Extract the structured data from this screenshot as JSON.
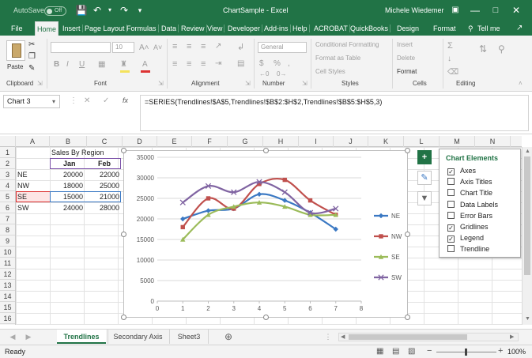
{
  "titlebar": {
    "autosave": "AutoSave",
    "autosave_state": "Off",
    "title": "ChartSample  -  Excel",
    "user": "Michele Wiedemer"
  },
  "ribbon_tabs": [
    "File",
    "Home",
    "Insert",
    "Page Layout",
    "Formulas",
    "Data",
    "Review",
    "View",
    "Developer",
    "Add-ins",
    "Help",
    "ACROBAT",
    "QuickBooks",
    "Design",
    "Format"
  ],
  "tell_me": "Tell me",
  "ribbon": {
    "clipboard": {
      "paste": "Paste",
      "label": "Clipboard"
    },
    "font": {
      "label": "Font",
      "size": "10",
      "bold": "B",
      "italic": "I",
      "underline": "U"
    },
    "alignment": {
      "label": "Alignment"
    },
    "number": {
      "label": "Number",
      "format": "General"
    },
    "styles": {
      "label": "Styles",
      "conditional": "Conditional Formatting",
      "table": "Format as Table",
      "cell": "Cell Styles"
    },
    "cells": {
      "label": "Cells",
      "insert": "Insert",
      "delete": "Delete",
      "format": "Format"
    },
    "editing": {
      "label": "Editing"
    }
  },
  "namebox": "Chart 3",
  "formula": "=SERIES(Trendlines!$A$5,Trendlines!$B$2:$H$2,Trendlines!$B$5:$H$5,3)",
  "columns": [
    "A",
    "B",
    "C",
    "D",
    "E",
    "F",
    "G",
    "H",
    "I",
    "J",
    "K",
    "L",
    "M",
    "N"
  ],
  "rows": [
    "1",
    "2",
    "3",
    "4",
    "5",
    "6",
    "7",
    "8",
    "9",
    "10",
    "11",
    "12",
    "13",
    "14",
    "15",
    "16"
  ],
  "sheet": {
    "title": "Sales By Region",
    "hdr_jan": "Jan",
    "hdr_feb": "Feb",
    "rows": [
      {
        "region": "NE",
        "jan": "20000",
        "feb": "22000"
      },
      {
        "region": "NW",
        "jan": "18000",
        "feb": "25000"
      },
      {
        "region": "SE",
        "jan": "15000",
        "feb": "21000"
      },
      {
        "region": "SW",
        "jan": "24000",
        "feb": "28000"
      }
    ]
  },
  "chart_data": {
    "type": "line",
    "x": [
      1,
      2,
      3,
      4,
      5,
      6,
      7
    ],
    "xlim": [
      0,
      8
    ],
    "ylim": [
      0,
      35000
    ],
    "x_ticks": [
      "0",
      "1",
      "2",
      "3",
      "4",
      "5",
      "6",
      "7",
      "8"
    ],
    "y_ticks": [
      "0",
      "5000",
      "10000",
      "15000",
      "20000",
      "25000",
      "30000",
      "35000"
    ],
    "grid": true,
    "legend_position": "right",
    "series": [
      {
        "name": "NE",
        "color": "#3a78c3",
        "marker": "diamond",
        "values": [
          20000,
          22000,
          22500,
          26000,
          24500,
          21500,
          17500
        ]
      },
      {
        "name": "NW",
        "color": "#c0504d",
        "marker": "square",
        "values": [
          18000,
          25000,
          22500,
          28500,
          29500,
          24500,
          21000
        ]
      },
      {
        "name": "SE",
        "color": "#9bbb59",
        "marker": "triangle",
        "values": [
          15000,
          21000,
          23000,
          24000,
          23000,
          21000,
          21000
        ]
      },
      {
        "name": "SW",
        "color": "#8064a2",
        "marker": "x",
        "values": [
          24000,
          28000,
          26500,
          29000,
          26500,
          21500,
          22500
        ]
      }
    ]
  },
  "chart_elements": {
    "title": "Chart Elements",
    "items": [
      {
        "label": "Axes",
        "checked": true
      },
      {
        "label": "Axis Titles",
        "checked": false
      },
      {
        "label": "Chart Title",
        "checked": false
      },
      {
        "label": "Data Labels",
        "checked": false
      },
      {
        "label": "Error Bars",
        "checked": false
      },
      {
        "label": "Gridlines",
        "checked": true
      },
      {
        "label": "Legend",
        "checked": true
      },
      {
        "label": "Trendline",
        "checked": false
      }
    ]
  },
  "sheet_tabs": [
    "Trendlines",
    "Secondary Axis",
    "Sheet3"
  ],
  "status": {
    "ready": "Ready",
    "zoom": "100%"
  },
  "accent": "#217346"
}
